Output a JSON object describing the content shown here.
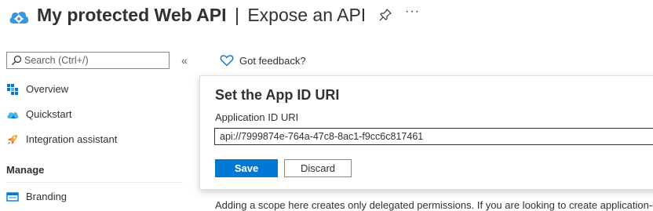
{
  "header": {
    "title_strong": "My protected Web API",
    "title_separator": "|",
    "title_sub": "Expose an API",
    "app_icon": "cloud-gear-icon",
    "pin_icon": "pin-icon",
    "more_label": "···"
  },
  "sidebar": {
    "search": {
      "placeholder": "Search (Ctrl+/)",
      "value": ""
    },
    "collapse_label": "«",
    "items": [
      {
        "label": "Overview",
        "icon": "grid-icon",
        "color": "#0078d4"
      },
      {
        "label": "Quickstart",
        "icon": "cloud-icon",
        "color": "#50b3e0"
      },
      {
        "label": "Integration assistant",
        "icon": "rocket-icon",
        "color": "#f2a33a"
      }
    ],
    "manage_header": "Manage",
    "manage_items": [
      {
        "label": "Branding",
        "icon": "branding-icon",
        "color": "#0078d4"
      }
    ]
  },
  "main": {
    "feedback_label": "Got feedback?",
    "panel": {
      "title": "Set the App ID URI",
      "field_label": "Application ID URI",
      "uri_value": "api://7999874e-764a-47c8-8ac1-f9cc6c817461",
      "save_label": "Save",
      "discard_label": "Discard"
    },
    "body_text": "Adding a scope here creates only delegated permissions. If you are looking to create application-only"
  },
  "colors": {
    "accent": "#0078d4",
    "text": "#323130",
    "border": "#8a8886"
  }
}
